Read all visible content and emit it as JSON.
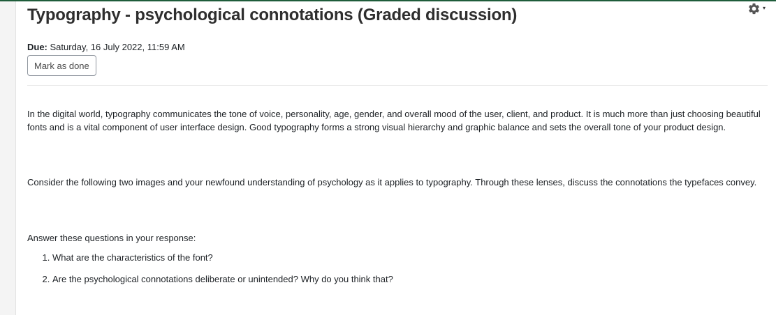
{
  "page": {
    "title": "Typography - psychological connotations (Graded discussion)",
    "due_label": "Due:",
    "due_value": " Saturday, 16 July 2022, 11:59 AM",
    "mark_done_label": "Mark as done"
  },
  "settings": {
    "icon": "gear-icon",
    "caret": "▾"
  },
  "description": {
    "paragraph1": "In the digital world, typography communicates the tone of voice, personality, age, gender, and overall mood of the user, client, and product. It is much more than just choosing beautiful fonts and is a vital component of user interface design. Good typography forms a strong visual hierarchy and graphic balance and sets the overall tone of your product design.",
    "paragraph2": "Consider the following two images and your newfound understanding of psychology as it applies to typography. Through these lenses, discuss the connotations the typefaces convey.",
    "paragraph3": "Answer these questions in your response:",
    "questions": [
      "What are the characteristics of the font?",
      "Are the psychological connotations deliberate or unintended? Why do you think that?"
    ]
  },
  "colors": {
    "top_bar": "#1e5c3a",
    "text": "#1d2125",
    "button_border": "#8f959e"
  }
}
